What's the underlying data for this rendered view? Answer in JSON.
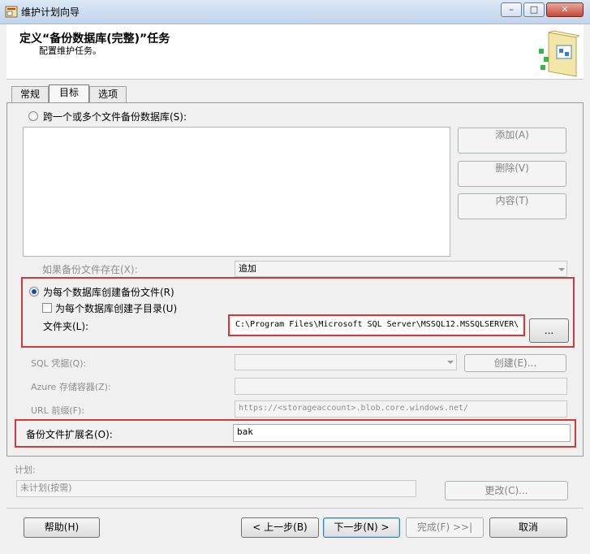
{
  "window": {
    "title": "维护计划向导"
  },
  "header": {
    "title": "定义“备份数据库(完整)”任务",
    "subtitle": "配置维护任务。"
  },
  "tabs": [
    {
      "label": "常规"
    },
    {
      "label": "目标"
    },
    {
      "label": "选项"
    }
  ],
  "target": {
    "backup_across_label": "跨一个或多个文件备份数据库(S):",
    "add_label": "添加(A)",
    "remove_label": "删除(V)",
    "contents_label": "内容(T)",
    "if_exists_label": "如果备份文件存在(X):",
    "if_exists_value": "追加",
    "per_db_file_label": "为每个数据库创建备份文件(R)",
    "per_db_subdir_label": "为每个数据库创建子目录(U)",
    "folder_label": "文件夹(L):",
    "folder_value": "C:\\Program Files\\Microsoft SQL Server\\MSSQL12.MSSQLSERVER\\",
    "browse_label": "...",
    "sql_credential_label": "SQL 凭据(Q):",
    "create_label": "创建(E)...",
    "azure_container_label": "Azure 存储容器(Z):",
    "url_prefix_label": "URL 前缀(F):",
    "url_prefix_value": "https://<storageaccount>.blob.core.windows.net/",
    "ext_label": "备份文件扩展名(O):",
    "ext_value": "bak"
  },
  "schedule": {
    "label": "计划:",
    "value": "未计划(按需)",
    "change_label": "更改(C)..."
  },
  "footer": {
    "help": "帮助(H)",
    "back": "< 上一步(B)",
    "next": "下一步(N) >",
    "finish": "完成(F) >>|",
    "cancel": "取消"
  },
  "colors": {
    "highlight_box": "#d23a3a",
    "title_gradient": "#c2d5ec"
  }
}
